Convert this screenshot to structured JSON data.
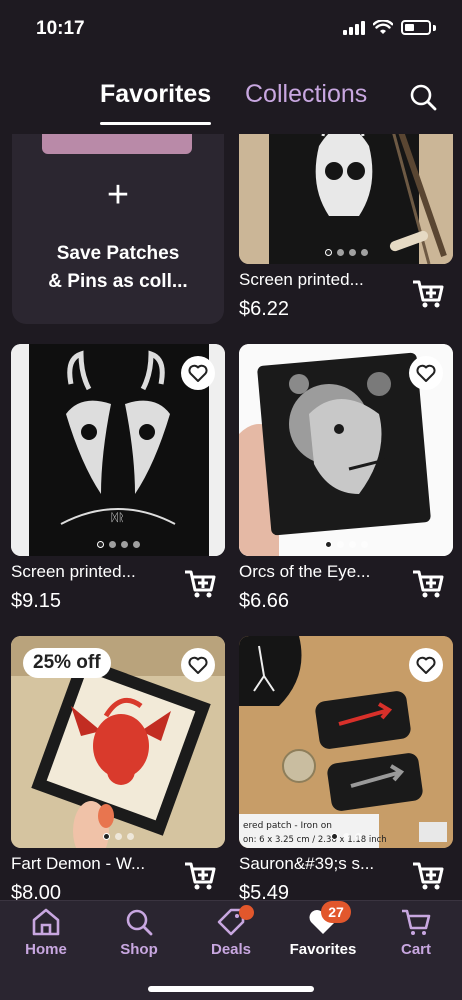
{
  "status_bar": {
    "time": "10:17"
  },
  "header": {
    "tabs": [
      {
        "label": "Favorites",
        "active": true
      },
      {
        "label": "Collections",
        "active": false
      }
    ],
    "search_icon": "search-icon"
  },
  "collection_card": {
    "plus": "+",
    "label_line1": "Save Patches",
    "label_line2": "& Pins as coll..."
  },
  "listings": [
    {
      "title": "Screen printed...",
      "price": "$6.22"
    },
    {
      "title": "Screen printed...",
      "price": "$9.15"
    },
    {
      "title": "Orcs of the Eye...",
      "price": "$6.66"
    },
    {
      "title": "Fart Demon - W...",
      "price": "$8.00",
      "badge": "25% off"
    },
    {
      "title": "Sauron&#39;s s...",
      "price": "$5.49"
    }
  ],
  "image_text": {
    "sauron_patch_caption_1": "ered patch - Iron on",
    "sauron_patch_caption_2": "on: 6 x 3.25 cm / 2.36 x 1.18 inch"
  },
  "bottom_nav": {
    "items": [
      {
        "label": "Home",
        "icon": "home-icon"
      },
      {
        "label": "Shop",
        "icon": "search-icon"
      },
      {
        "label": "Deals",
        "icon": "tag-icon"
      },
      {
        "label": "Favorites",
        "icon": "heart-icon",
        "active": true,
        "count": "27"
      },
      {
        "label": "Cart",
        "icon": "cart-icon"
      }
    ]
  },
  "colors": {
    "background": "#1e1a21",
    "accent_purple": "#c8a7e0",
    "badge_orange": "#e2572c"
  }
}
